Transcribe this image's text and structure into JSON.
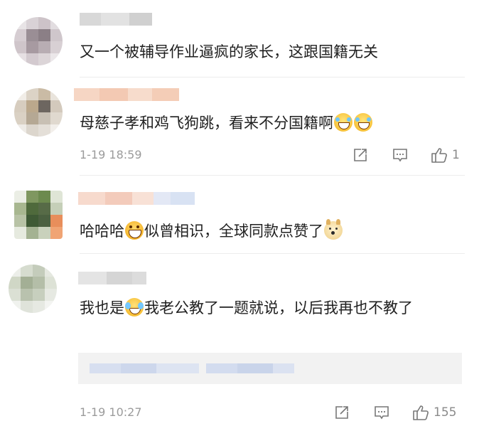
{
  "comments": [
    {
      "text": "又一个被辅导作业逼疯的家长，这跟国籍无关"
    },
    {
      "text_before": "母慈子孝和鸡飞狗跳，看来不分国籍啊",
      "emojis": [
        "laugh-cry-emoji",
        "laugh-cry-emoji"
      ],
      "time": "1-19 18:59",
      "like_count": "1"
    },
    {
      "text_before": "哈哈哈",
      "text_after": "似曾相识，全球同款点赞了",
      "emojis": [
        "grin-emoji",
        "doge-emoji"
      ]
    },
    {
      "text_before": "我也是",
      "text_after": "我老公教了一题就说，以后我再也不教了",
      "emojis": [
        "cry-laugh-emoji"
      ],
      "time": "1-19 10:27",
      "like_count": "155"
    }
  ],
  "icons": [
    "share-icon",
    "comment-icon",
    "like-icon"
  ],
  "colors": {
    "text": "#1f1f1f",
    "meta": "#9b9b9b",
    "divider": "#ececec",
    "reply_bg": "#f2f2f2"
  }
}
